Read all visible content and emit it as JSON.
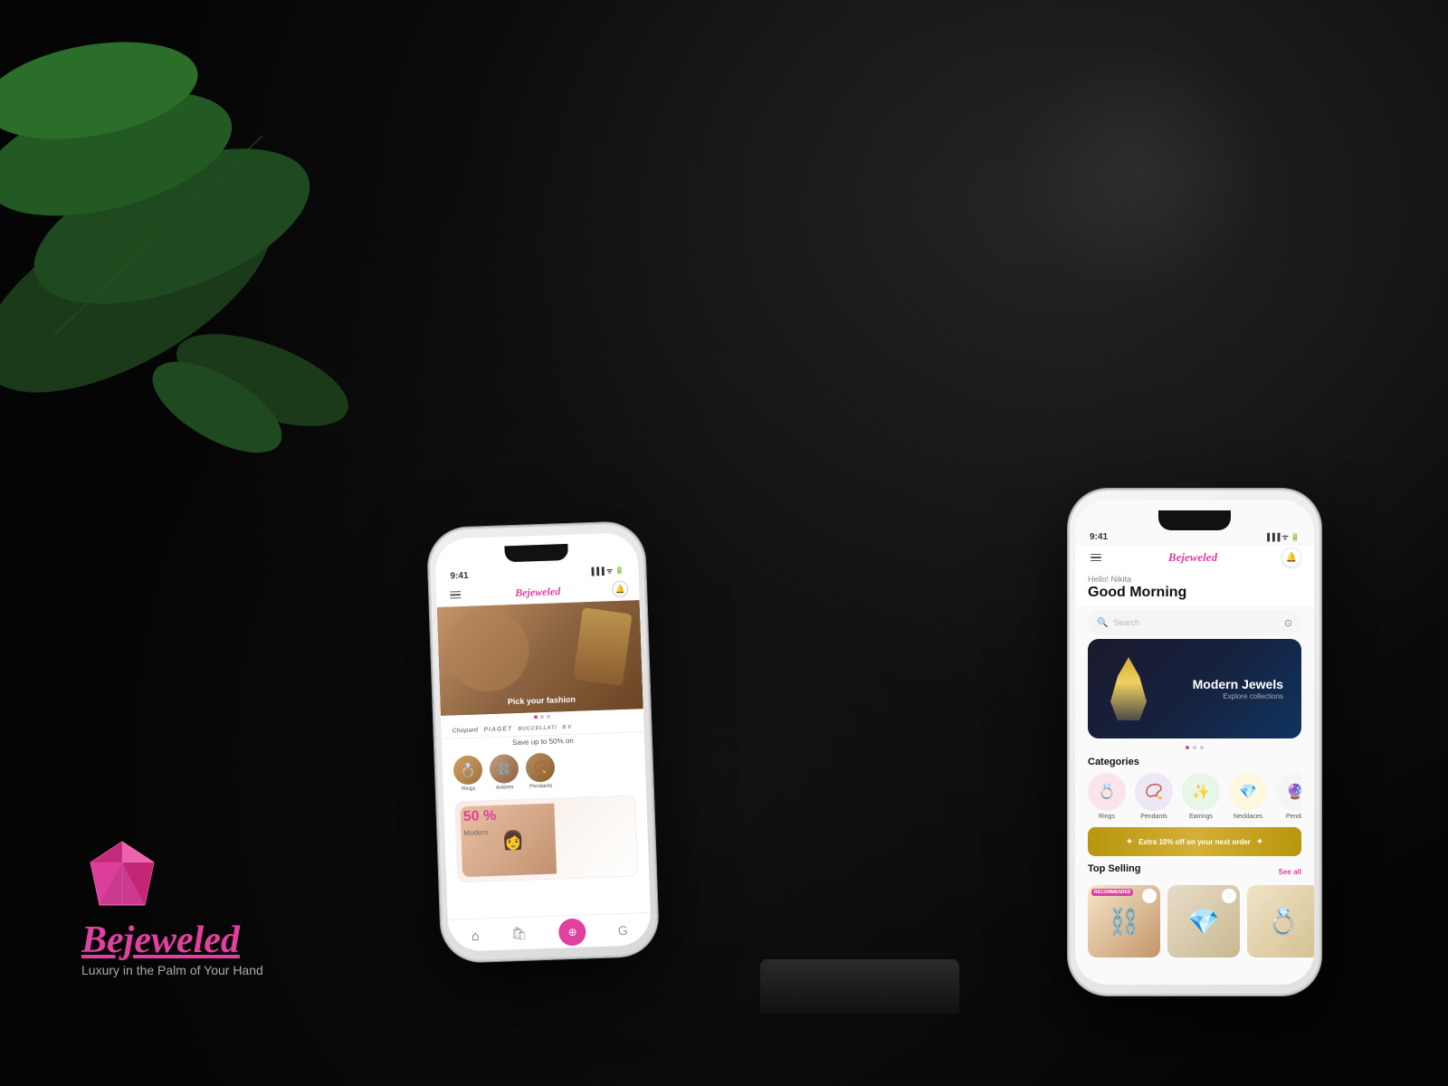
{
  "background": {
    "color": "#0a0a0a"
  },
  "brand": {
    "name": "Bejeweled",
    "tagline": "Luxury in the Palm of Your Hand",
    "diamond_icon": "💎"
  },
  "left_phone": {
    "status_time": "9:41",
    "app_logo": "Bejeweled",
    "hero_text": "Pick your fashion",
    "brand_logos": [
      "Chopard",
      "PIAGET",
      "BUCCELLATI",
      "B V"
    ],
    "save_text": "Save up to 50% on",
    "categories": [
      {
        "label": "Rings",
        "icon": "💍"
      },
      {
        "label": "Anklets",
        "icon": "⛓️"
      },
      {
        "label": "Pendants",
        "icon": "📿"
      }
    ],
    "promo_percent": "50 %",
    "promo_text": "Modern"
  },
  "right_phone": {
    "status_time": "9:41",
    "app_logo": "Bejeweled",
    "greeting_sub": "Hello! Nikita",
    "greeting_main": "Good Morning",
    "search_placeholder": "Search",
    "hero_banner": {
      "title": "Modern Jewels",
      "subtitle": "Explore collections"
    },
    "categories_title": "Categories",
    "categories": [
      {
        "label": "Rings",
        "icon": "💍",
        "bg": "pink"
      },
      {
        "label": "Pendants",
        "icon": "📿",
        "bg": "purple"
      },
      {
        "label": "Earrings",
        "icon": "✨",
        "bg": "green"
      },
      {
        "label": "Necklaces",
        "icon": "💎",
        "bg": "cream"
      },
      {
        "label": "Penda",
        "icon": "🔮",
        "bg": "gray"
      }
    ],
    "promo_strip": "Extra 10% off on your next order",
    "top_selling_title": "Top Selling",
    "see_all": "See all",
    "products": [
      {
        "badge": "RECOMMENDED",
        "has_heart": true
      },
      {
        "has_heart": true
      },
      {
        "has_heart": false
      }
    ]
  }
}
